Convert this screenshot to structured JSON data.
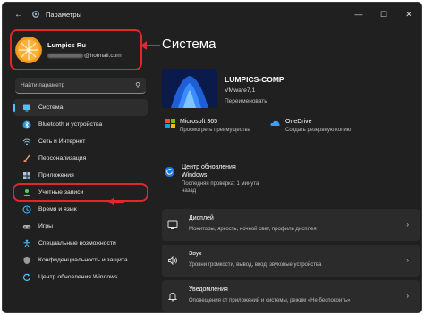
{
  "titlebar": {
    "back_icon": "arrow-left-icon",
    "title": "Параметры",
    "minimize": "—",
    "maximize": "☐",
    "close": "✕"
  },
  "profile": {
    "name": "Lumpics Ru",
    "email_suffix": "@hotmail.com"
  },
  "search": {
    "placeholder": "Найти параметр"
  },
  "nav": {
    "items": [
      {
        "label": "Система",
        "icon": "monitor-icon",
        "color": "#4cc2ff"
      },
      {
        "label": "Bluetooth и устройства",
        "icon": "bluetooth-icon",
        "color": "#4cc2ff"
      },
      {
        "label": "Сеть и Интернет",
        "icon": "network-icon",
        "color": "#8fb8e8"
      },
      {
        "label": "Персонализация",
        "icon": "brush-icon",
        "color": "#e8a87c"
      },
      {
        "label": "Приложения",
        "icon": "apps-icon",
        "color": "#b0c4de"
      },
      {
        "label": "Учетные записи",
        "icon": "person-icon",
        "color": "#3fd47a"
      },
      {
        "label": "Время и язык",
        "icon": "globe-clock-icon",
        "color": "#4cc2ff"
      },
      {
        "label": "Игры",
        "icon": "gamepad-icon",
        "color": "#b0b0b0"
      },
      {
        "label": "Специальные возможности",
        "icon": "accessibility-icon",
        "color": "#4cc2ff"
      },
      {
        "label": "Конфиденциальность и защита",
        "icon": "shield-icon",
        "color": "#9a9a9a"
      },
      {
        "label": "Центр обновления Windows",
        "icon": "update-icon",
        "color": "#4cc2ff"
      }
    ]
  },
  "main": {
    "heading": "Система",
    "pc": {
      "name": "LUMPICS-COMP",
      "model": "VMware7,1",
      "rename": "Переименовать"
    },
    "quick": [
      {
        "title": "Microsoft 365",
        "sub": "Просмотреть преимущества",
        "icon": "microsoft-365-icon"
      },
      {
        "title": "OneDrive",
        "sub": "Создать резервную копию",
        "icon": "onedrive-icon"
      },
      {
        "title": "Центр обновления",
        "title2": "Windows",
        "sub": "Последняя проверка: 1 минута",
        "sub2": "назад",
        "icon": "update-icon"
      }
    ],
    "cards": [
      {
        "title": "Дисплей",
        "sub": "Мониторы, яркость, ночной свет, профиль дисплея",
        "icon": "display-icon"
      },
      {
        "title": "Звук",
        "sub": "Уровни громкости, вывод, ввод, звуковые устройства",
        "icon": "speaker-icon"
      },
      {
        "title": "Уведомления",
        "sub": "Оповещения от приложений и системы, режим «Не беспокоить»",
        "icon": "bell-icon"
      }
    ]
  }
}
